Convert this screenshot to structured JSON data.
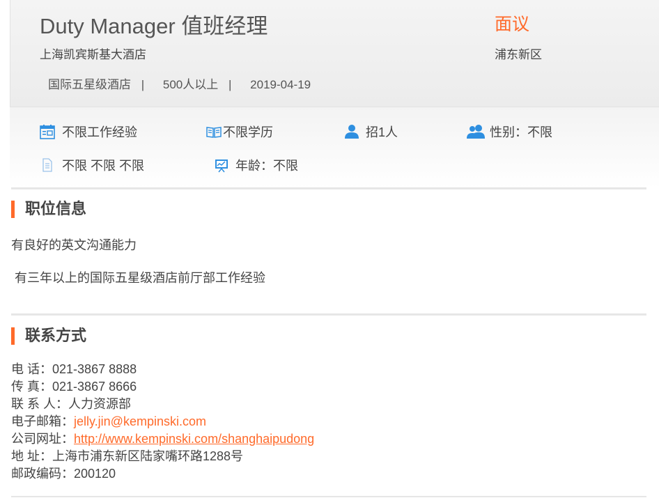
{
  "job": {
    "title": "Duty Manager 值班经理",
    "company": "上海凯宾斯基大酒店",
    "company_type": "国际五星级酒店",
    "company_size": "500人以上",
    "separator": "|",
    "date": "2019-04-19",
    "salary": "面议",
    "district": "浦东新区"
  },
  "tags": {
    "experience": "不限工作经验",
    "education": "不限学历",
    "headcount": "招1人",
    "gender": "性别：不限",
    "other": "不限 不限 不限",
    "age": "年龄：不限"
  },
  "icons": {
    "experience": "calendar-icon",
    "education": "book-icon",
    "headcount": "person-icon",
    "gender": "people-icon",
    "other": "document-icon",
    "age": "presentation-icon",
    "icon_color": "#2e8fe0",
    "accent_color": "#ff6a2a"
  },
  "job_info": {
    "heading": "职位信息",
    "lines": [
      "有良好的英文沟通能力",
      "有三年以上的国际五星级酒店前厅部工作经验"
    ]
  },
  "contact": {
    "heading": "联系方式",
    "phone_label": "电 话：",
    "phone": "021-3867 8888",
    "fax_label": "传 真：",
    "fax": "021-3867 8666",
    "person_label": "联 系 人：",
    "person": "人力资源部",
    "email_label": "电子邮箱：",
    "email": "jelly.jin@kempinski.com",
    "website_label": "公司网址：",
    "website": "http://www.kempinski.com/shanghaipudong",
    "address_label": "地 址：",
    "address": "上海市浦东新区陆家嘴环路1288号",
    "postcode_label": "邮政编码：",
    "postcode": "200120"
  }
}
